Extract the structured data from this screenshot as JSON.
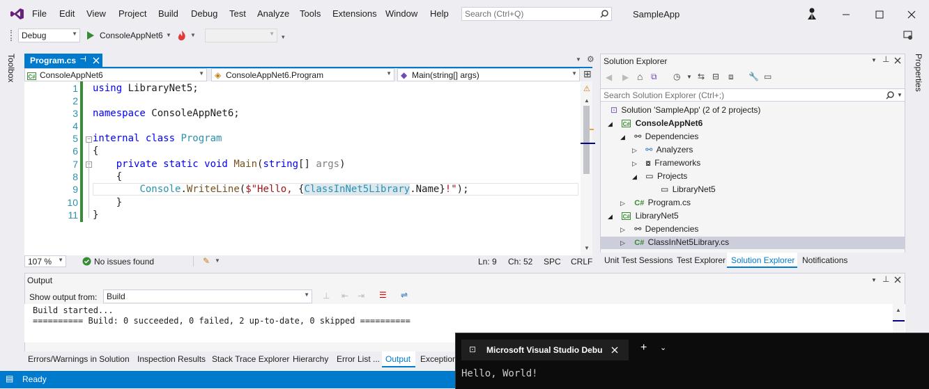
{
  "menu": [
    "File",
    "Edit",
    "View",
    "Project",
    "Build",
    "Debug",
    "Test",
    "Analyze",
    "Tools",
    "Extensions",
    "Window",
    "Help"
  ],
  "search_placeholder": "Search (Ctrl+Q)",
  "app_title": "SampleApp",
  "toolbar": {
    "config": "Debug",
    "start_target": "ConsoleAppNet6"
  },
  "editor": {
    "tab_label": "Program.cs",
    "nav_project": "ConsoleAppNet6",
    "nav_class": "ConsoleAppNet6.Program",
    "nav_member": "Main(string[] args)",
    "line_numbers": [
      "1",
      "2",
      "3",
      "4",
      "5",
      "6",
      "7",
      "8",
      "9",
      "10",
      "11"
    ],
    "zoom": "107 %",
    "issues": "No issues found",
    "ln": "Ln: 9",
    "ch": "Ch: 52",
    "spc": "SPC",
    "crlf": "CRLF"
  },
  "solution_explorer": {
    "title": "Solution Explorer",
    "search_placeholder": "Search Solution Explorer (Ctrl+;)",
    "items": [
      "Solution 'SampleApp' (2 of 2 projects)",
      "ConsoleAppNet6",
      "Dependencies",
      "Analyzers",
      "Frameworks",
      "Projects",
      "LibraryNet5",
      "Program.cs",
      "LibraryNet5",
      "Dependencies",
      "ClassInNet5Library.cs"
    ],
    "tabs": [
      "Unit Test Sessions",
      "Test Explorer",
      "Solution Explorer",
      "Notifications"
    ]
  },
  "side_labels": {
    "left": "Toolbox",
    "right": "Properties"
  },
  "output": {
    "title": "Output",
    "show_from_label": "Show output from:",
    "source": "Build",
    "lines": [
      "Build started...",
      "========== Build: 0 succeeded, 0 failed, 2 up-to-date, 0 skipped =========="
    ]
  },
  "bottom_tabs": [
    "Errors/Warnings in Solution",
    "Inspection Results",
    "Stack Trace Explorer",
    "Hierarchy",
    "Error List ...",
    "Output",
    "Exception"
  ],
  "status": "Ready",
  "terminal": {
    "tab_title": "Microsoft Visual Studio Debu",
    "output": "Hello, World!"
  },
  "colors": {
    "accent": "#007acc",
    "terminal_bg": "#0c0c0c"
  }
}
